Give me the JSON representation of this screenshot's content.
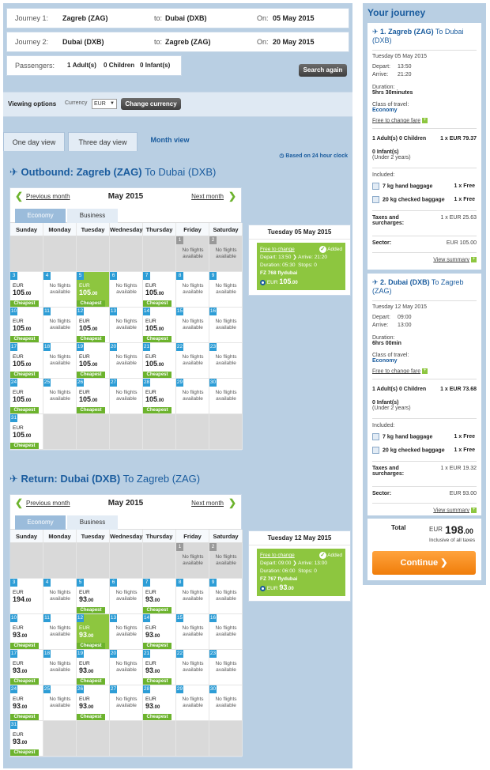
{
  "search": {
    "j1": {
      "label": "Journey 1:",
      "from": "Zagreb (ZAG)",
      "to_label": "to:",
      "to": "Dubai (DXB)",
      "on_label": "On:",
      "date": "05 May 2015"
    },
    "j2": {
      "label": "Journey 2:",
      "from": "Dubai (DXB)",
      "to_label": "to:",
      "to": "Zagreb (ZAG)",
      "on_label": "On:",
      "date": "20 May 2015"
    },
    "passengers": {
      "label": "Passengers:",
      "adults": "1",
      "adults_label": "Adult(s)",
      "children": "0",
      "children_label": "Children",
      "infants": "0",
      "infants_label": "Infant(s)"
    },
    "search_again": "Search again"
  },
  "viewing": {
    "label": "Viewing options",
    "currency_label": "Currency",
    "currency": "EUR",
    "change": "Change currency"
  },
  "tabs": {
    "one": "One day view",
    "three": "Three day view",
    "month": "Month view"
  },
  "clock": "Based on 24 hour clock",
  "common": {
    "prev": "Previous month",
    "next": "Next month",
    "month": "May 2015",
    "economy": "Economy",
    "business": "Business",
    "cheapest": "Cheapest",
    "eur": "EUR",
    "nf1": "No flights",
    "nf2": "available",
    "days": [
      "Sunday",
      "Monday",
      "Tuesday",
      "Wednesday",
      "Thursday",
      "Friday",
      "Saturday"
    ]
  },
  "outbound": {
    "prefix": "Outbound:",
    "from": "Zagreb (ZAG)",
    "to": "To Dubai (DXB)",
    "calendar": [
      [
        "",
        "",
        "",
        "",
        "",
        "1",
        "2"
      ],
      [
        "3",
        "4",
        "5",
        "6",
        "7",
        "8",
        "9"
      ],
      [
        "10",
        "11",
        "12",
        "13",
        "14",
        "15",
        "16"
      ],
      [
        "17",
        "18",
        "19",
        "20",
        "21",
        "22",
        "23"
      ],
      [
        "24",
        "25",
        "26",
        "27",
        "28",
        "29",
        "30"
      ],
      [
        "31",
        "",
        "",
        "",
        "",
        "",
        ""
      ]
    ],
    "prices": {
      "3": "105",
      "5": "105",
      "7": "105",
      "10": "105",
      "12": "105",
      "14": "105",
      "17": "105",
      "19": "105",
      "21": "105",
      "24": "105",
      "26": "105",
      "28": "105",
      "31": "105"
    },
    "cheapest": [
      "3",
      "5",
      "7",
      "10",
      "12",
      "14",
      "17",
      "19",
      "21",
      "24",
      "26",
      "28",
      "31"
    ],
    "selected": "5",
    "box": {
      "date": "Tuesday 05 May 2015",
      "free": "Free to change",
      "added": "Added",
      "depart": "Depart: 13:50",
      "arrive": "Arrive: 21:20",
      "duration": "Duration: 05:30",
      "stops": "Stops: 0",
      "flight": "FZ 768 flydubai",
      "eur": "EUR",
      "price": "105",
      "dec": ".00"
    }
  },
  "ret": {
    "prefix": "Return:",
    "from": "Dubai (DXB)",
    "to": "To Zagreb (ZAG)",
    "calendar": [
      [
        "",
        "",
        "",
        "",
        "",
        "1",
        "2"
      ],
      [
        "3",
        "4",
        "5",
        "6",
        "7",
        "8",
        "9"
      ],
      [
        "10",
        "11",
        "12",
        "13",
        "14",
        "15",
        "16"
      ],
      [
        "17",
        "18",
        "19",
        "20",
        "21",
        "22",
        "23"
      ],
      [
        "24",
        "25",
        "26",
        "27",
        "28",
        "29",
        "30"
      ],
      [
        "31",
        "",
        "",
        "",
        "",
        "",
        ""
      ]
    ],
    "prices": {
      "3": "194",
      "5": "93",
      "7": "93",
      "10": "93",
      "12": "93",
      "14": "93",
      "17": "93",
      "19": "93",
      "21": "93",
      "24": "93",
      "26": "93",
      "28": "93",
      "31": "93"
    },
    "cheapest": [
      "5",
      "7",
      "10",
      "12",
      "14",
      "17",
      "19",
      "21",
      "24",
      "26",
      "28",
      "31"
    ],
    "selected": "12",
    "box": {
      "date": "Tuesday 12 May 2015",
      "free": "Free to change",
      "added": "Added",
      "depart": "Depart: 09:00",
      "arrive": "Arrive: 13:00",
      "duration": "Duration: 06:00",
      "stops": "Stops: 0",
      "flight": "FZ 767 flydubai",
      "eur": "EUR",
      "price": "93",
      "dec": ".00"
    }
  },
  "journey": {
    "title": "Your journey",
    "leg1": {
      "num": "1.",
      "from": "Zagreb (ZAG)",
      "to": "To Dubai (DXB)",
      "date": "Tuesday 05 May 2015",
      "depart_l": "Depart:",
      "depart": "13:50",
      "arrive_l": "Arrive:",
      "arrive": "21:20",
      "duration_l": "Duration:",
      "duration": "5hrs 30minutes",
      "class_l": "Class of travel:",
      "class": "Economy",
      "free": "Free to change fare",
      "pax": "1 Adult(s)  0 Children",
      "pax_price": "1 x  EUR 79.37",
      "inf": "0 Infant(s)",
      "inf_sub": "(Under 2 years)",
      "included": "Included:",
      "hand": "7 kg hand baggage",
      "hand_v": "1 x Free",
      "checked": "20 kg checked baggage",
      "checked_v": "1 x Free",
      "taxes": "Taxes and surcharges:",
      "taxes_v": "1 x EUR 25.63",
      "sector": "Sector:",
      "sector_v": "EUR 105.00",
      "view": "View summary"
    },
    "leg2": {
      "num": "2.",
      "from": "Dubai (DXB)",
      "to": "To Zagreb (ZAG)",
      "date": "Tuesday 12 May 2015",
      "depart_l": "Depart:",
      "depart": "09:00",
      "arrive_l": "Arrive:",
      "arrive": "13:00",
      "duration_l": "Duration:",
      "duration": "6hrs 00min",
      "class_l": "Class of travel:",
      "class": "Economy",
      "free": "Free to change fare",
      "pax": "1 Adult(s)  0 Children",
      "pax_price": "1 x  EUR 73.68",
      "inf": "0 Infant(s)",
      "inf_sub": "(Under 2 years)",
      "included": "Included:",
      "hand": "7 kg hand baggage",
      "hand_v": "1 x Free",
      "checked": "20 kg checked baggage",
      "checked_v": "1 x Free",
      "taxes": "Taxes and surcharges:",
      "taxes_v": "1 x EUR 19.32",
      "sector": "Sector:",
      "sector_v": "EUR 93.00",
      "view": "View summary"
    },
    "total_l": "Total",
    "total_cur": "EUR",
    "total": "198",
    "total_dec": ".00",
    "incl": "Inclusive of all taxes",
    "continue": "Continue"
  }
}
